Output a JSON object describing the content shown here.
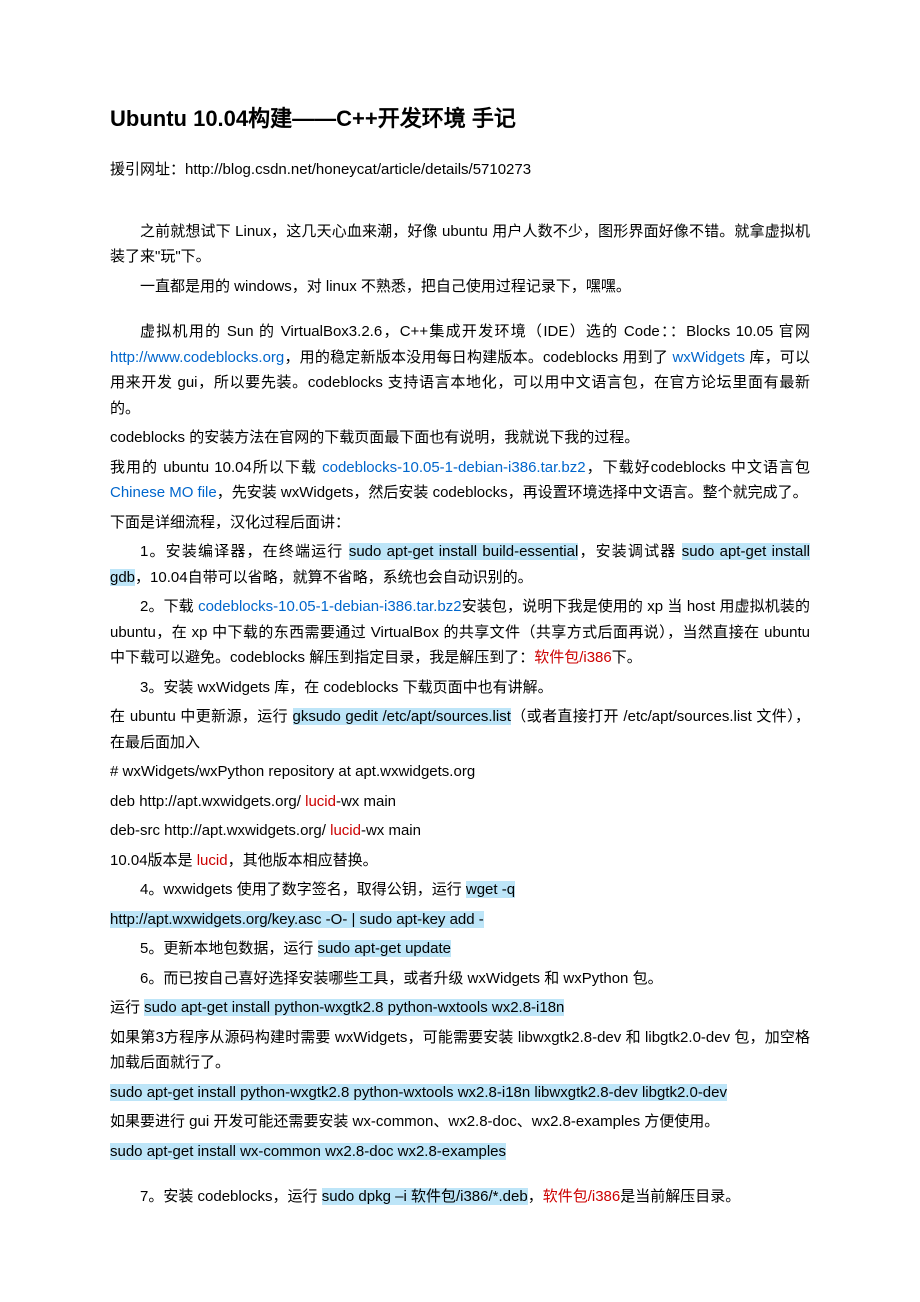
{
  "title": "Ubuntu 10.04构建——C++开发环境 手记",
  "source_prefix": "援引网址：",
  "source_url": "http://blog.csdn.net/honeycat/article/details/5710273",
  "intro": {
    "p1": "之前就想试下 Linux，这几天心血来潮，好像 ubuntu 用户人数不少，图形界面好像不错。就拿虚拟机装了来\"玩\"下。",
    "p2": "一直都是用的 windows，对 linux 不熟悉，把自己使用过程记录下，嘿嘿。"
  },
  "env": {
    "line1_pre": "虚拟机用的 Sun 的 VirtualBox3.2.6，C++集成开发环境（IDE）选的 Code：：Blocks 10.05 官网 ",
    "line1_link": "http://www.codeblocks.org",
    "line1_post": "，用的稳定新版本没用每日构建版本。codeblocks 用到了",
    "line2_link": "wxWidgets",
    "line2_post": " 库，可以用来开发 gui，所以要先装。codeblocks 支持语言本地化，可以用中文语言包，在官方论坛里面有最新的。",
    "line3": "codeblocks 的安装方法在官网的下载页面最下面也有说明，我就说下我的过程。",
    "line4_pre": "我用的 ubuntu 10.04所以下载 ",
    "line4_link": "codeblocks-10.05-1-debian-i386.tar.bz2",
    "line4_post": "，下载好codeblocks 中文语言包 ",
    "line4_link2": "Chinese MO file",
    "line4_post2": "，先安装 wxWidgets，然后安装 codeblocks，再设置环境选择中文语言。整个就完成了。",
    "line5": "下面是详细流程，汉化过程后面讲："
  },
  "steps": {
    "s1_pre": "1。安装编译器，在终端运行 ",
    "s1_cmd1": "sudo apt-get install build-essential",
    "s1_mid": "，安装调试器 ",
    "s1_cmd2": "sudo apt-get install gdb",
    "s1_post": "，10.04自带可以省略，就算不省略，系统也会自动识别的。",
    "s2_pre": "2。下载 ",
    "s2_link": "codeblocks-10.05-1-debian-i386.tar.bz2",
    "s2_mid": "安装包，说明下我是使用的 xp 当 host 用虚拟机装的 ubuntu，在 xp 中下载的东西需要通过 VirtualBox 的共享文件（共享方式后面再说），当然直接在 ubuntu 中下载可以避免。codeblocks 解压到指定目录，我是解压到了：",
    "s2_red": "软件包/i386",
    "s2_post": "下。",
    "s3": "3。安装 wxWidgets 库，在 codeblocks 下载页面中也有讲解。",
    "s3_pre": "在 ubuntu 中更新源，运行 ",
    "s3_cmd": "gksudo gedit /etc/apt/sources.list",
    "s3_post": "（或者直接打开 /etc/apt/sources.list 文件），在最后面加入",
    "s3_repo1": " # wxWidgets/wxPython repository at apt.wxwidgets.org",
    "s3_repo2_pre": " deb http://apt.wxwidgets.org/ ",
    "s3_repo2_red": "lucid",
    "s3_repo2_post": "-wx main",
    "s3_repo3_pre": " deb-src http://apt.wxwidgets.org/ ",
    "s3_repo3_red": "lucid",
    "s3_repo3_post": "-wx main",
    "s3_note_pre": "10.04版本是 ",
    "s3_note_red": "lucid",
    "s3_note_post": "，其他版本相应替换。",
    "s4_pre": "4。wxwidgets 使用了数字签名，取得公钥，运行 ",
    "s4_cmd1": "wget -q ",
    "s4_cmd2": "http://apt.wxwidgets.org/key.asc -O- | sudo apt-key add -",
    "s5_pre": "5。更新本地包数据，运行 ",
    "s5_cmd": "sudo apt-get update",
    "s6": "6。而已按自己喜好选择安装哪些工具，或者升级 wxWidgets 和 wxPython 包。",
    "s6_line2_pre": "运行 ",
    "s6_cmd1": "sudo apt-get install python-wxgtk2.8 python-wxtools wx2.8-i18n",
    "s6_line3": "如果第3方程序从源码构建时需要 wxWidgets，可能需要安装 libwxgtk2.8-dev 和 libgtk2.0-dev 包，加空格加载后面就行了。",
    "s6_cmd2": "sudo apt-get install python-wxgtk2.8 python-wxtools wx2.8-i18n libwxgtk2.8-dev libgtk2.0-dev",
    "s6_line5": "如果要进行 gui 开发可能还需要安装 wx-common、wx2.8-doc、wx2.8-examples 方便使用。",
    "s6_cmd3": "sudo apt-get install wx-common wx2.8-doc wx2.8-examples",
    "s7_pre": "7。安装 codeblocks，运行 ",
    "s7_cmd": "sudo dpkg –i 软件包/i386/*.deb",
    "s7_mid": "，",
    "s7_red": "软件包/i386",
    "s7_post": "是当前解压目录。"
  }
}
